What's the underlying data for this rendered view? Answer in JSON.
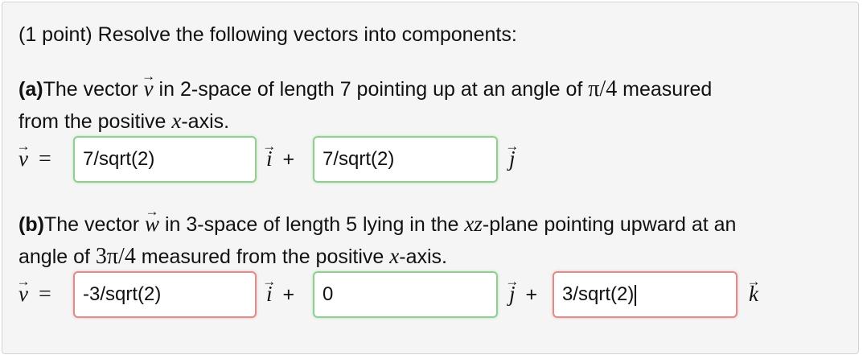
{
  "header": {
    "text": "(1 point) Resolve the following vectors into components:"
  },
  "part_a": {
    "label": "(a)",
    "pre_vec": "The vector ",
    "vec_name": "v",
    "post_vec": " in 2-space of length 7 pointing up at an angle of ",
    "angle": "π/4",
    "post_angle": " measured",
    "line2_pre": "from the positive ",
    "axis": "x",
    "line2_post": "-axis.",
    "lhs_vec": "v",
    "equals": "=",
    "inputs": [
      {
        "value": "7/sqrt(2)",
        "status": "correct"
      },
      {
        "value": "7/sqrt(2)",
        "status": "correct"
      }
    ],
    "units": [
      "i",
      "j"
    ],
    "plus": "+"
  },
  "part_b": {
    "label": "(b)",
    "pre_vec": "The vector ",
    "vec_name": "w",
    "post_vec": " in 3-space of length 5 lying in the ",
    "plane": "xz",
    "post_plane": "-plane pointing upward at an",
    "line2_pre": "angle of ",
    "angle": "3π/4",
    "line2_mid": " measured from the positive ",
    "axis": "x",
    "line2_post": "-axis.",
    "lhs_vec": "v",
    "equals": "=",
    "inputs": [
      {
        "value": "-3/sqrt(2)",
        "status": "incorrect"
      },
      {
        "value": "0",
        "status": "correct"
      },
      {
        "value": "3/sqrt(2)",
        "status": "incorrect"
      }
    ],
    "units": [
      "i",
      "j",
      "k"
    ],
    "plus": "+"
  },
  "colors": {
    "correct_border": "#8ed08e",
    "incorrect_border": "#e38a8a",
    "panel_bg": "#f5f5f5"
  }
}
